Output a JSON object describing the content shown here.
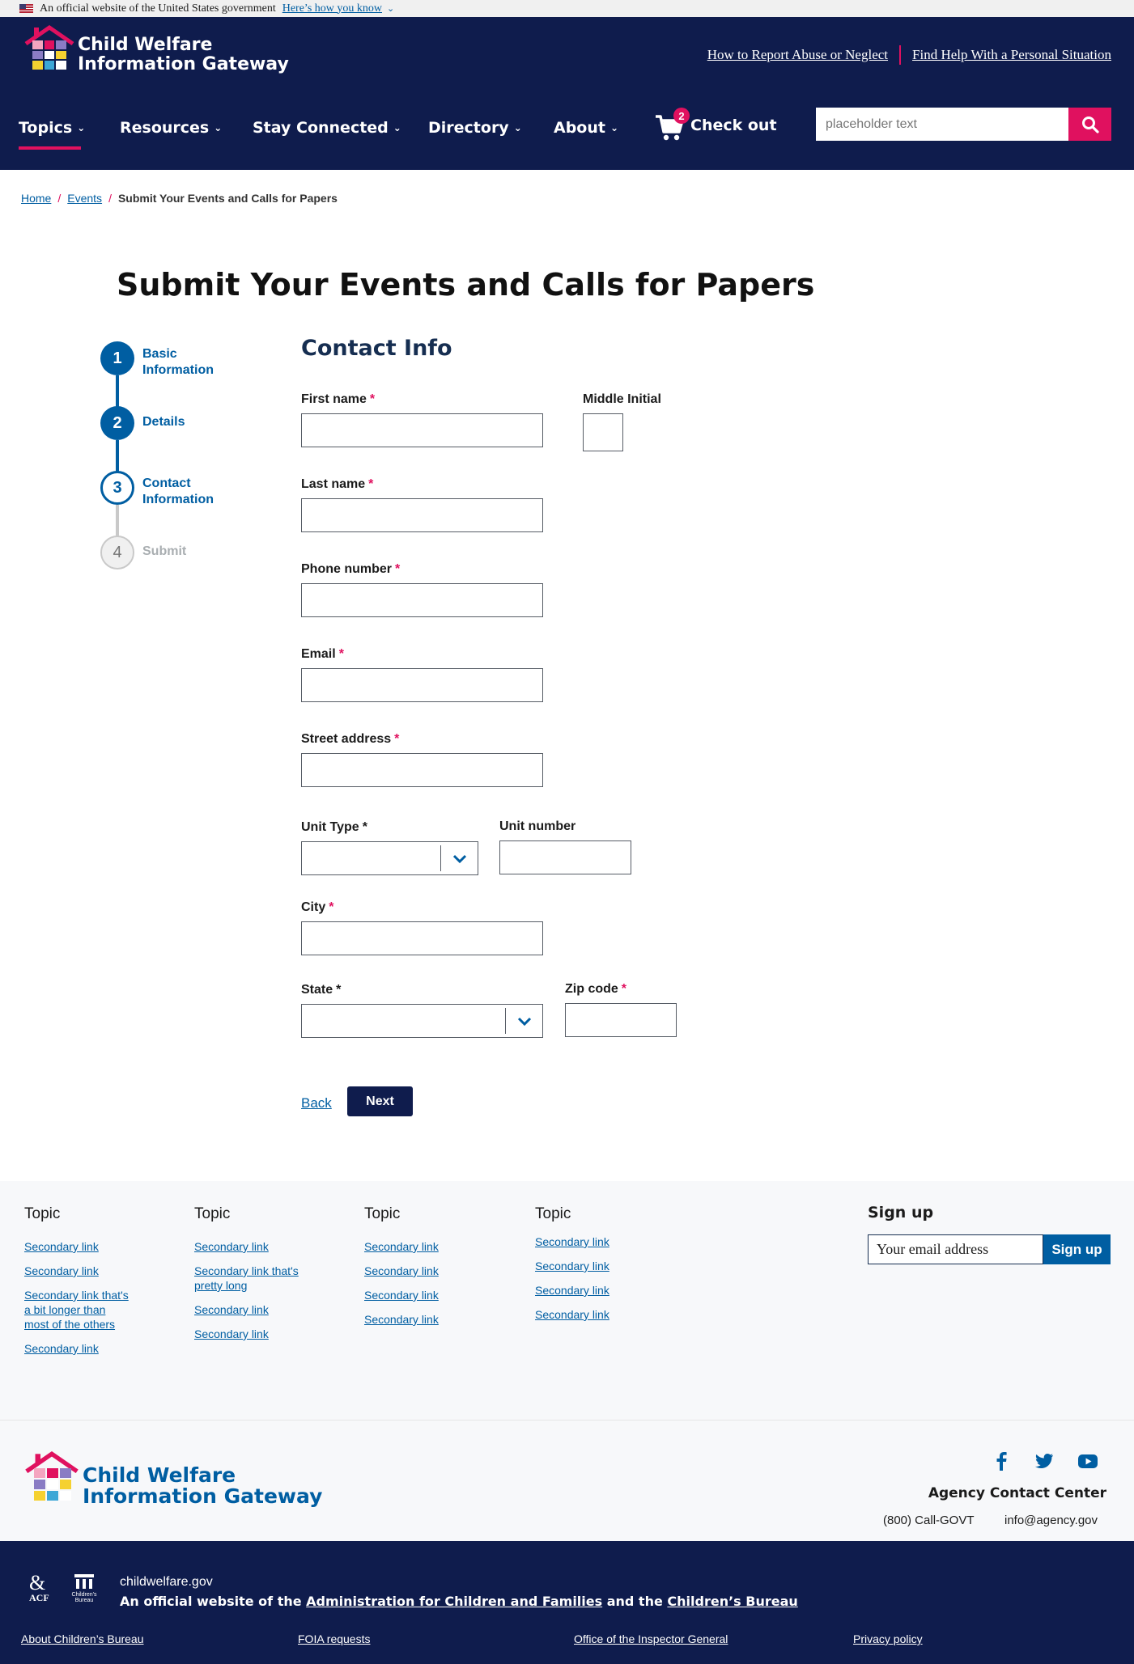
{
  "gov_banner": {
    "text": "An official website of the United States government",
    "link": "Here’s how you know"
  },
  "header": {
    "logo_line1": "Child Welfare",
    "logo_line2": "Information Gateway",
    "util_links": [
      "How to Report Abuse or Neglect",
      "Find Help With a Personal Situation"
    ],
    "nav": [
      "Topics",
      "Resources",
      "Stay Connected",
      "Directory",
      "About"
    ],
    "cart_count": "2",
    "checkout": "Check out",
    "search_placeholder": "placeholder text",
    "accent": "#e0115f",
    "navy": "#0f1c4d"
  },
  "breadcrumb": {
    "home": "Home",
    "events": "Events",
    "current": "Submit Your Events and Calls for Papers"
  },
  "page_title": "Submit Your Events and Calls for Papers",
  "stepper": [
    {
      "num": "1",
      "label": "Basic Information",
      "state": "complete"
    },
    {
      "num": "2",
      "label": "Details",
      "state": "complete"
    },
    {
      "num": "3",
      "label": "Contact Information",
      "state": "current"
    },
    {
      "num": "4",
      "label": "Submit",
      "state": "upcoming"
    }
  ],
  "form": {
    "title": "Contact Info",
    "first_name": "First name",
    "middle_initial": "Middle Initial",
    "last_name": "Last name",
    "phone": "Phone number",
    "email": "Email",
    "street": "Street address",
    "unit_type": "Unit Type",
    "unit_number": "Unit number",
    "city": "City",
    "state": "State",
    "zip": "Zip code",
    "required_mark": "*",
    "back": "Back",
    "next": "Next"
  },
  "footer": {
    "columns": [
      {
        "title": "Topic",
        "links": [
          "Secondary link",
          "Secondary link",
          "Secondary link that's a bit longer than most of the others",
          "Secondary link"
        ]
      },
      {
        "title": "Topic",
        "links": [
          "Secondary link",
          "Secondary link that's pretty long",
          "Secondary link",
          "Secondary link"
        ]
      },
      {
        "title": "Topic",
        "links": [
          "Secondary link",
          "Secondary link",
          "Secondary link",
          "Secondary link"
        ]
      },
      {
        "title": "Topic",
        "links": [
          "Secondary link",
          "Secondary link",
          "Secondary link",
          "Secondary link"
        ]
      }
    ],
    "signup_title": "Sign up",
    "signup_placeholder": "Your email address",
    "signup_button": "Sign up",
    "logo_line1": "Child Welfare",
    "logo_line2": "Information Gateway",
    "social_icons": [
      "facebook-icon",
      "twitter-icon",
      "youtube-icon"
    ],
    "agency_title": "Agency Contact Center",
    "agency_phone": "(800) Call-GOVT",
    "agency_email": "info@agency.gov",
    "acf_label": "ACF",
    "cb_label": "Children's Bureau",
    "domain": "childwelfare.gov",
    "official_prefix": "An official website of the",
    "official_acf": "Administration for Children and Families",
    "official_and": "and the",
    "official_cb": "Children’s Bureau",
    "bottom_links": [
      "About Children’s Bureau",
      "FOIA requests",
      "Office of the Inspector General",
      "Privacy policy"
    ]
  }
}
